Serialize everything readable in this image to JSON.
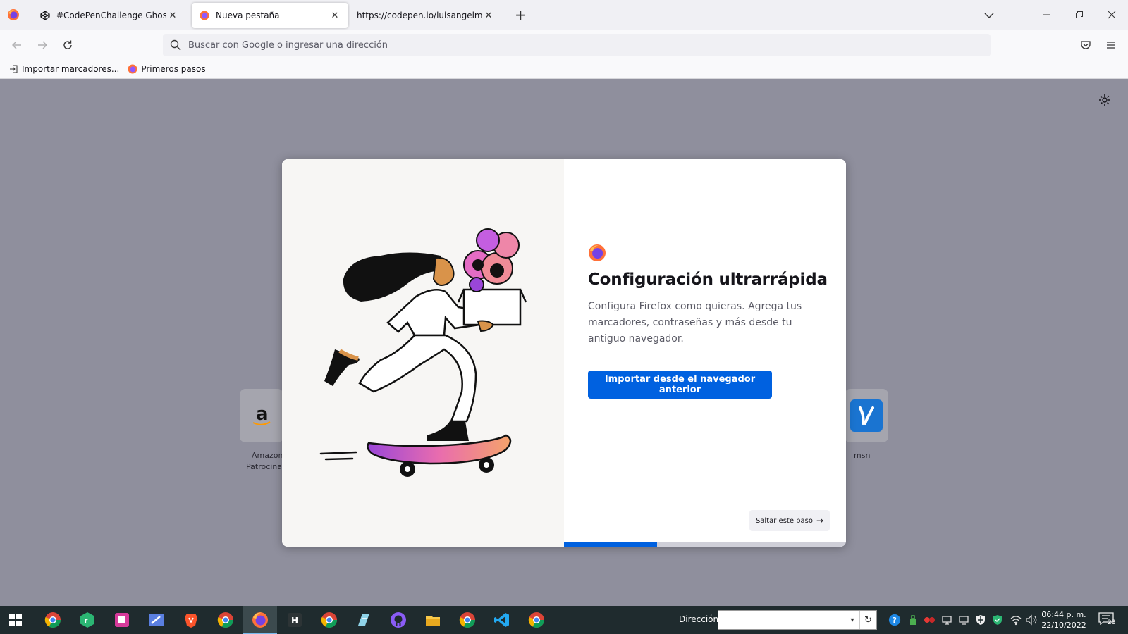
{
  "tabs": [
    {
      "title": "#CodePenChallenge Ghosts",
      "active": false
    },
    {
      "title": "Nueva pestaña",
      "active": true
    },
    {
      "title": "https://codepen.io/luisangelmaciel",
      "active": false
    }
  ],
  "urlbar": {
    "placeholder": "Buscar con Google o ingresar una dirección"
  },
  "bookmarks": [
    {
      "label": "Importar marcadores...",
      "icon": "import-icon"
    },
    {
      "label": "Primeros pasos",
      "icon": "firefox-icon"
    }
  ],
  "shortcuts": [
    {
      "title": "Amazon",
      "subtitle": "Patrocinado",
      "icon": "amazon-icon"
    },
    {
      "title": "msn",
      "subtitle": "",
      "icon": "msn-icon"
    }
  ],
  "modal": {
    "title": "Configuración ultrarrápida",
    "description": "Configura Firefox como quieras. Agrega tus marcadores, contraseñas y más desde tu antiguo navegador.",
    "primary_button": "Importar desde el navegador anterior",
    "skip_button": "Saltar este paso",
    "progress": 0.33
  },
  "taskbar": {
    "address_label": "Dirección",
    "address_value": "",
    "clock_time": "06:44 p. m.",
    "clock_date": "22/10/2022",
    "notification_count": "23"
  },
  "colors": {
    "accent": "#0061e0",
    "tabstrip": "#f0f0f4",
    "overlay": "#8f8f9d",
    "taskbar": "#1f2b2e"
  }
}
